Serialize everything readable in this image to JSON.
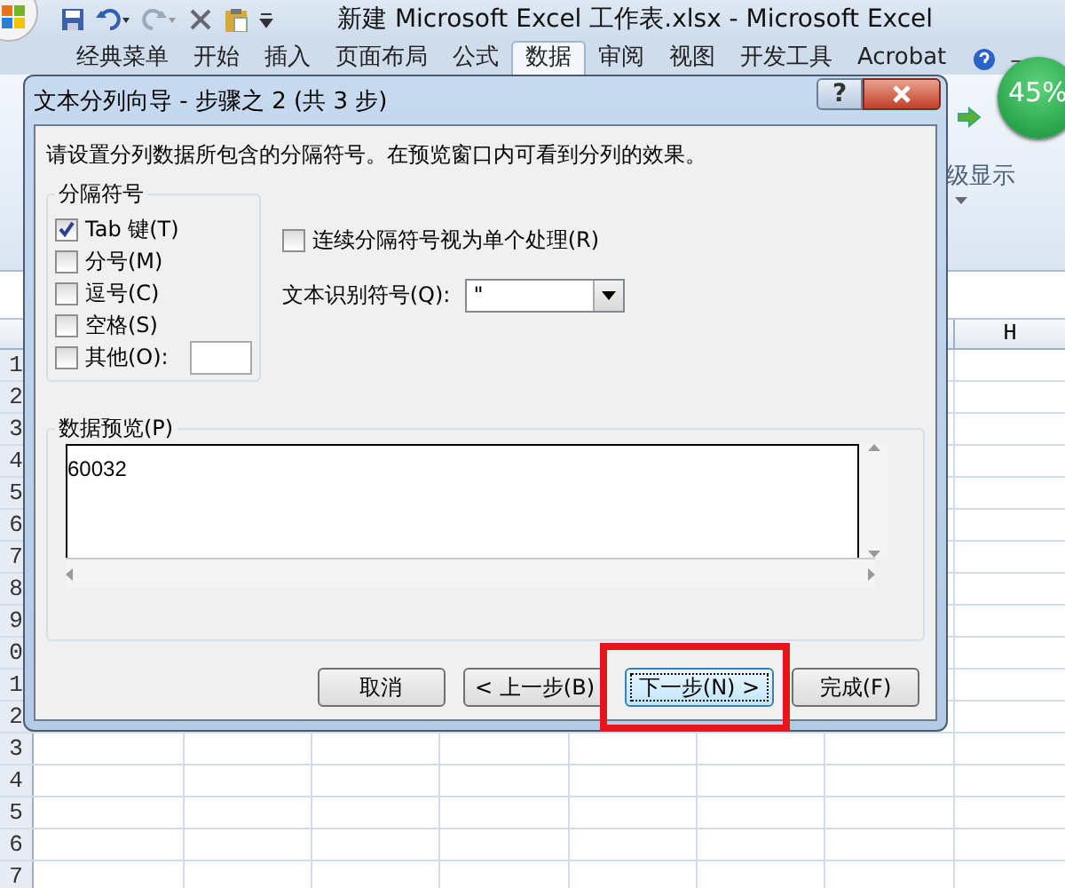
{
  "window": {
    "title": "新建 Microsoft Excel 工作表.xlsx - Microsoft Excel"
  },
  "ribbon": {
    "tabs": [
      {
        "label": "经典菜单",
        "selected": false
      },
      {
        "label": "开始",
        "selected": false
      },
      {
        "label": "插入",
        "selected": false
      },
      {
        "label": "页面布局",
        "selected": false
      },
      {
        "label": "公式",
        "selected": false
      },
      {
        "label": "数据",
        "selected": true
      },
      {
        "label": "审阅",
        "selected": false
      },
      {
        "label": "视图",
        "selected": false
      },
      {
        "label": "开发工具",
        "selected": false
      },
      {
        "label": "Acrobat",
        "selected": false
      }
    ],
    "minimize": "–",
    "group_label": "级显示"
  },
  "badge": {
    "text": "45%"
  },
  "sheet": {
    "column": "H",
    "rows": [
      "1",
      "2",
      "3",
      "4",
      "5",
      "6",
      "7",
      "8",
      "9",
      "0",
      "1",
      "2",
      "3",
      "4",
      "5",
      "6",
      "7"
    ]
  },
  "dialog": {
    "title": "文本分列向导 - 步骤之 2 (共 3 步)",
    "help": "?",
    "instruction": "请设置分列数据所包含的分隔符号。在预览窗口内可看到分列的效果。",
    "delimiters": {
      "label": "分隔符号",
      "options": [
        {
          "label": "Tab 键(T)",
          "checked": true,
          "kind": "plain"
        },
        {
          "label": "分号(M)",
          "checked": false,
          "kind": "plain"
        },
        {
          "label": "逗号(C)",
          "checked": false,
          "kind": "plain"
        },
        {
          "label": "空格(S)",
          "checked": false,
          "kind": "plain"
        },
        {
          "label": "其他(O):",
          "checked": false,
          "kind": "other"
        }
      ]
    },
    "consecutive": {
      "label": "连续分隔符号视为单个处理(R)",
      "checked": false
    },
    "qualifier": {
      "label": "文本识别符号(Q):",
      "value": "\""
    },
    "preview": {
      "label": "数据预览(P)",
      "lines": [
        "60032"
      ]
    },
    "buttons": [
      {
        "label": "取消",
        "highlighted": false
      },
      {
        "label": "< 上一步(B)",
        "highlighted": false
      },
      {
        "label": "下一步(N) >",
        "highlighted": true
      },
      {
        "label": "完成(F)",
        "highlighted": false
      }
    ]
  }
}
